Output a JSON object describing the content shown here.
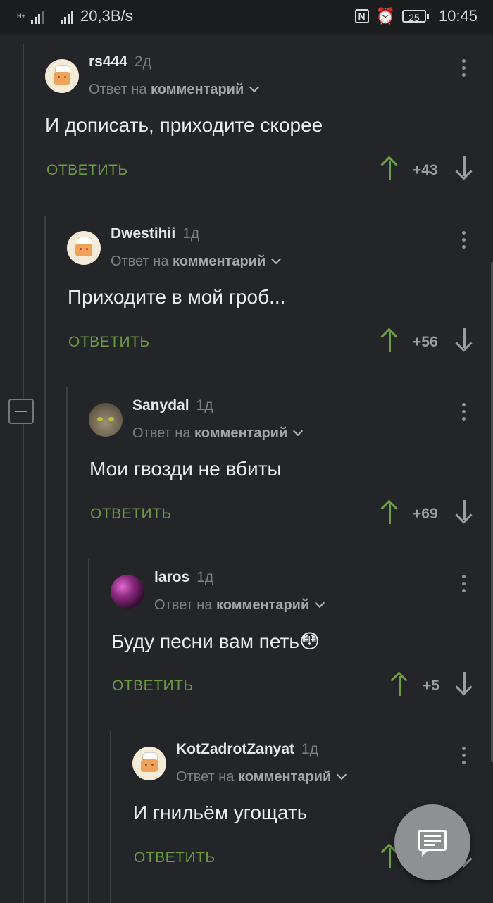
{
  "status_bar": {
    "network_speed": "20,3B/s",
    "battery": "25",
    "time": "10:45",
    "signal_tag": "H+"
  },
  "comments": [
    {
      "username": "rs444",
      "time": "2д",
      "reply_prefix": "Ответ на",
      "reply_target": "комментарий",
      "text": "И дописать, приходите скорее",
      "reply_label": "ОТВЕТИТЬ",
      "score": "+43",
      "avatar": "chef-avatar"
    },
    {
      "username": "Dwestihii",
      "time": "1д",
      "reply_prefix": "Ответ на",
      "reply_target": "комментарий",
      "text": "Приходите в мой гроб...",
      "reply_label": "ОТВЕТИТЬ",
      "score": "+56",
      "avatar": "chef-avatar"
    },
    {
      "username": "Sanydal",
      "time": "1д",
      "reply_prefix": "Ответ на",
      "reply_target": "комментарий",
      "text": "Мои гвозди не вбиты",
      "reply_label": "ОТВЕТИТЬ",
      "score": "+69",
      "avatar": "cat-avatar"
    },
    {
      "username": "laros",
      "time": "1д",
      "reply_prefix": "Ответ на",
      "reply_target": "комментарий",
      "text": "Буду песни вам петь😳",
      "reply_label": "ОТВЕТИТЬ",
      "score": "+5",
      "avatar": "planet-avatar"
    },
    {
      "username": "KotZadrotZanyat",
      "time": "1д",
      "reply_prefix": "Ответ на",
      "reply_target": "комментарий",
      "text": "И гнильём угощать",
      "reply_label": "ОТВЕТИТЬ",
      "score": "",
      "avatar": "chef-avatar"
    }
  ],
  "colors": {
    "background": "#232528",
    "reply_green": "#6b9a45",
    "upvote_green": "#6ea042",
    "fab": "#8e9194"
  }
}
